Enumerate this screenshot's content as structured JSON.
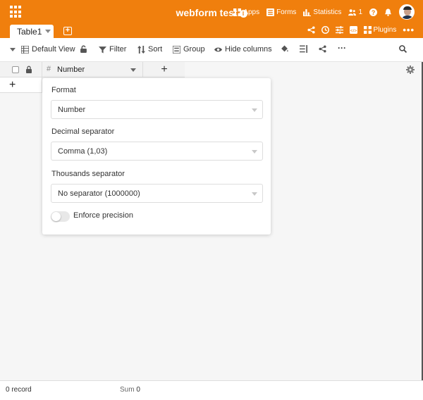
{
  "header": {
    "base_title": "webform test",
    "apps_label": "Apps",
    "forms_label": "Forms",
    "statistics_label": "Statistics",
    "collaborators_count": "1",
    "brand_color": "#f07f0d"
  },
  "tabs": {
    "active_label": "Table1",
    "plugins_label": "Plugins"
  },
  "toolbar": {
    "view_label": "Default View",
    "filter_label": "Filter",
    "sort_label": "Sort",
    "group_label": "Group",
    "hide_columns_label": "Hide columns"
  },
  "grid": {
    "column_name": "Number",
    "column_type_icon": "#",
    "add_column_symbol": "+",
    "add_row_symbol": "+"
  },
  "popover": {
    "format_label": "Format",
    "format_value": "Number",
    "decimal_label": "Decimal separator",
    "decimal_value": "Comma (1,03)",
    "thousands_label": "Thousands separator",
    "thousands_value": "No separator (1000000)",
    "precision_label": "Enforce precision",
    "precision_enabled": false
  },
  "statusbar": {
    "record_count": "0 record",
    "sum_label": "Sum",
    "sum_value": "0"
  }
}
